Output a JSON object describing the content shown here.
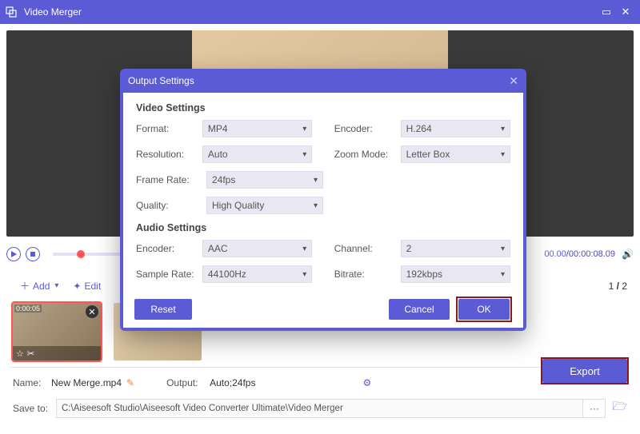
{
  "app": {
    "title": "Video Merger"
  },
  "transport": {
    "time_current": "00.00",
    "time_total": "00:00:08.09"
  },
  "toolbar": {
    "add": "Add",
    "edit": "Edit"
  },
  "pager": {
    "current": "1",
    "sep": "/",
    "total": "2"
  },
  "thumbs": [
    {
      "ts": "0:00:05"
    },
    {
      "ts": ""
    }
  ],
  "bottom": {
    "name_label": "Name:",
    "name_value": "New Merge.mp4",
    "output_label": "Output:",
    "output_value": "Auto;24fps",
    "save_label": "Save to:",
    "save_path": "C:\\Aiseesoft Studio\\Aiseesoft Video Converter Ultimate\\Video Merger",
    "export": "Export"
  },
  "modal": {
    "title": "Output Settings",
    "video_heading": "Video Settings",
    "audio_heading": "Audio Settings",
    "labels": {
      "format": "Format:",
      "encoder": "Encoder:",
      "resolution": "Resolution:",
      "zoom": "Zoom Mode:",
      "frame": "Frame Rate:",
      "quality": "Quality:",
      "aencoder": "Encoder:",
      "channel": "Channel:",
      "sample": "Sample Rate:",
      "bitrate": "Bitrate:"
    },
    "values": {
      "format": "MP4",
      "encoder": "H.264",
      "resolution": "Auto",
      "zoom": "Letter Box",
      "frame": "24fps",
      "quality": "High Quality",
      "aencoder": "AAC",
      "channel": "2",
      "sample": "44100Hz",
      "bitrate": "192kbps"
    },
    "buttons": {
      "reset": "Reset",
      "cancel": "Cancel",
      "ok": "OK"
    }
  }
}
